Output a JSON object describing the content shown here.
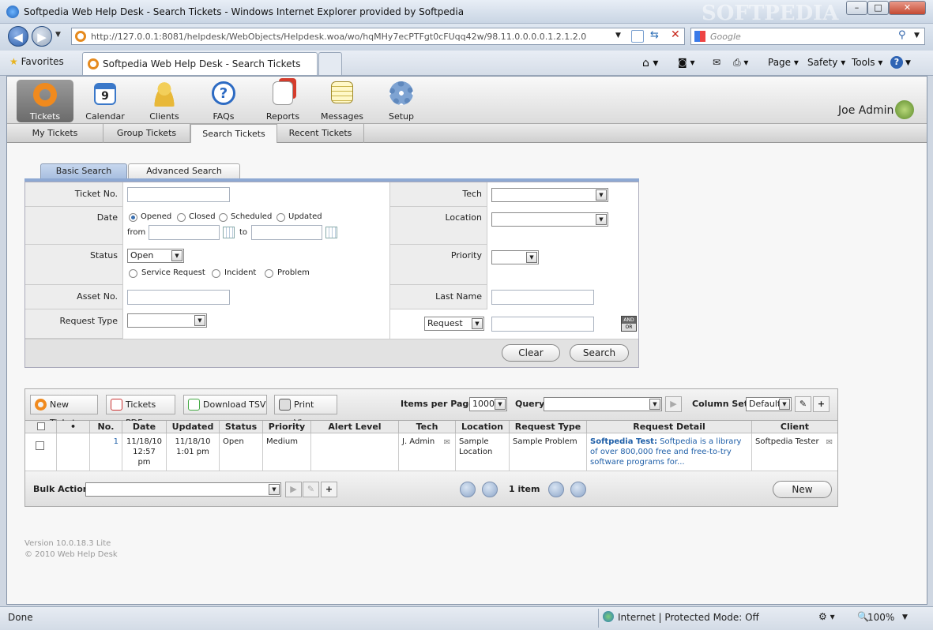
{
  "window": {
    "title": "Softpedia Web Help Desk - Search Tickets - Windows Internet Explorer provided by Softpedia",
    "min": "–",
    "max": "□",
    "close": "✕"
  },
  "browser": {
    "url": "http://127.0.0.1:8081/helpdesk/WebObjects/Helpdesk.woa/wo/hqMHy7ecPTFgt0cFUqq42w/98.11.0.0.0.0.1.2.1.2.0",
    "search_placeholder": "Google",
    "favorites": "Favorites",
    "tab": "Softpedia Web Help Desk - Search Tickets",
    "page": "Page",
    "safety": "Safety",
    "tools": "Tools"
  },
  "toolbar": {
    "items": [
      {
        "label": "Tickets",
        "color": "#f08a1e"
      },
      {
        "label": "Calendar",
        "color": "#3a78c9"
      },
      {
        "label": "Clients",
        "color": "#e8b838"
      },
      {
        "label": "FAQs",
        "color": "#2d6bc3"
      },
      {
        "label": "Reports",
        "color": "#d43c2c"
      },
      {
        "label": "Messages",
        "color": "#e3c341"
      },
      {
        "label": "Setup",
        "color": "#5f88bd"
      }
    ],
    "user": "Joe Admin"
  },
  "subnav": [
    "My Tickets",
    "Group Tickets",
    "Search Tickets",
    "Recent Tickets"
  ],
  "search_tabs": [
    "Basic Search",
    "Advanced Search"
  ],
  "form": {
    "ticket_no": "Ticket No.",
    "tech": "Tech",
    "date": "Date",
    "location": "Location",
    "date_opts": [
      "Opened",
      "Closed",
      "Scheduled",
      "Updated"
    ],
    "from": "from",
    "to": "to",
    "status": "Status",
    "status_val": "Open",
    "priority": "Priority",
    "type_opts": [
      "Service Request",
      "Incident",
      "Problem"
    ],
    "asset_no": "Asset No.",
    "last_name": "Last Name",
    "request_type": "Request Type",
    "request_sel": "Request",
    "andor_and": "AND",
    "andor_or": "OR",
    "clear": "Clear",
    "search": "Search"
  },
  "grid": {
    "new_ticket": "New Ticket",
    "tickets_pdf": "Tickets PDF",
    "download_tsv": "Download TSV",
    "print_view": "Print View",
    "items_per_page_label": "Items per Page",
    "items_per_page": "1000",
    "query_label": "Query",
    "column_set_label": "Column Set",
    "column_set": "Default",
    "headers": [
      "•",
      "No.",
      "Date",
      "Updated",
      "Status",
      "Priority",
      "Alert Level",
      "Tech",
      "Location",
      "Request Type",
      "Request Detail",
      "Client"
    ],
    "row": {
      "no": "1",
      "date": "11/18/10 12:57 pm",
      "updated": "11/18/10 1:01 pm",
      "status": "Open",
      "priority": "Medium",
      "alert": "",
      "tech": "J. Admin",
      "location": "Sample Location",
      "request_type": "Sample Problem",
      "detail_title": "Softpedia Test:",
      "detail": "Softpedia is a library of over 800,000 free and free-to-try software programs for...",
      "client": "Softpedia Tester"
    },
    "bulk_action": "Bulk Action",
    "count": "1 item",
    "new": "New"
  },
  "footer": {
    "version": "Version 10.0.18.3 Lite",
    "copyright": "© 2010 Web Help Desk"
  },
  "status": {
    "left": "Done",
    "zone": "Internet | Protected Mode: Off",
    "zoom": "100%"
  }
}
